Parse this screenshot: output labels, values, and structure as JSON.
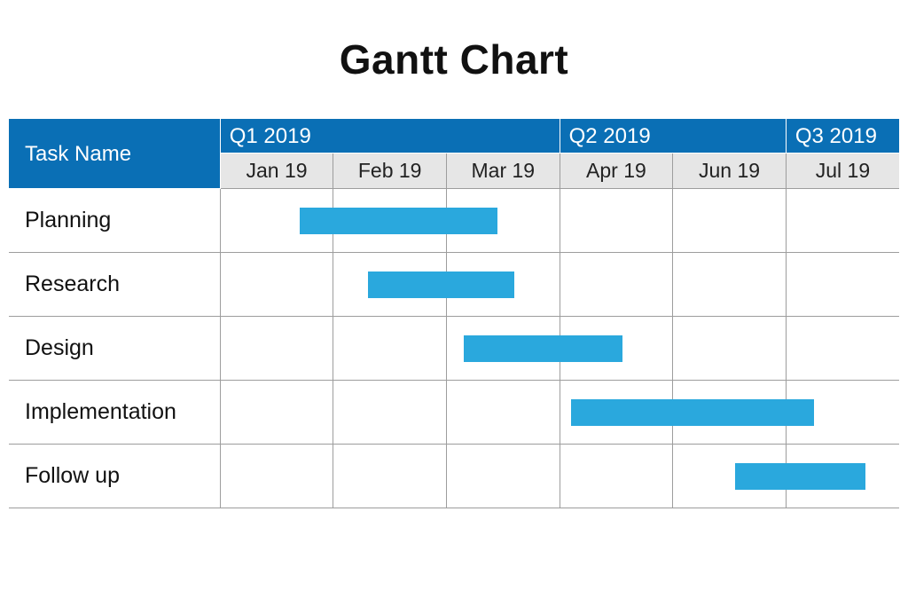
{
  "title": "Gantt Chart",
  "header": {
    "task_name_label": "Task Name",
    "quarters": [
      "Q1 2019",
      "Q2 2019",
      "Q3 2019"
    ],
    "quarter_spans": [
      3,
      2,
      1
    ],
    "months": [
      "Jan 19",
      "Feb 19",
      "Mar 19",
      "Apr 19",
      "Jun 19",
      "Jul 19"
    ]
  },
  "tasks": [
    {
      "name": "Planning",
      "start": 0.7,
      "end": 2.45
    },
    {
      "name": "Research",
      "start": 1.3,
      "end": 2.6
    },
    {
      "name": "Design",
      "start": 2.15,
      "end": 3.55
    },
    {
      "name": "Implementation",
      "start": 3.1,
      "end": 5.25
    },
    {
      "name": "Follow up",
      "start": 4.55,
      "end": 5.7
    }
  ],
  "colors": {
    "header_blue": "#0a6fb5",
    "bar_blue": "#2aa8dd",
    "month_bg": "#e6e6e6",
    "grid": "#9d9d9d"
  },
  "chart_data": {
    "type": "bar",
    "title": "Gantt Chart",
    "xlabel": "",
    "ylabel": "",
    "x_categories": [
      "Jan 19",
      "Feb 19",
      "Mar 19",
      "Apr 19",
      "Jun 19",
      "Jul 19"
    ],
    "x_groups": [
      {
        "label": "Q1 2019",
        "span": [
          "Jan 19",
          "Feb 19",
          "Mar 19"
        ]
      },
      {
        "label": "Q2 2019",
        "span": [
          "Apr 19",
          "Jun 19"
        ]
      },
      {
        "label": "Q3 2019",
        "span": [
          "Jul 19"
        ]
      }
    ],
    "series": [
      {
        "name": "Planning",
        "start": "mid Jan 19",
        "end": "mid Mar 19",
        "start_idx": 0.7,
        "end_idx": 2.45
      },
      {
        "name": "Research",
        "start": "early Feb 19",
        "end": "mid Mar 19",
        "start_idx": 1.3,
        "end_idx": 2.6
      },
      {
        "name": "Design",
        "start": "early Mar 19",
        "end": "mid Apr 19",
        "start_idx": 2.15,
        "end_idx": 3.55
      },
      {
        "name": "Implementation",
        "start": "early Apr 19",
        "end": "early Jul 19",
        "start_idx": 3.1,
        "end_idx": 5.25
      },
      {
        "name": "Follow up",
        "start": "mid Jun 19",
        "end": "mid Jul 19",
        "start_idx": 4.55,
        "end_idx": 5.7
      }
    ],
    "xlim_idx": [
      0,
      6
    ],
    "note": "start_idx/end_idx are in month-column units (0..6) estimated from bar positions on the grid."
  }
}
